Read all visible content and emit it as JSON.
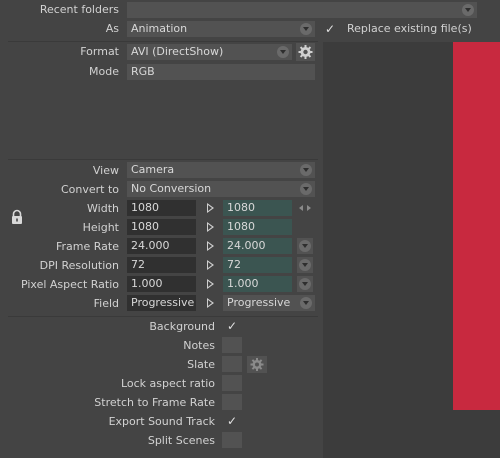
{
  "recent_folders": {
    "label": "Recent folders",
    "value": ""
  },
  "as": {
    "label": "As",
    "value": "Animation"
  },
  "replace_existing": {
    "label": "Replace existing file(s)",
    "checked": "✓"
  },
  "format": {
    "label": "Format",
    "value": "AVI (DirectShow)"
  },
  "mode": {
    "label": "Mode",
    "value": "RGB"
  },
  "view": {
    "label": "View",
    "value": "Camera"
  },
  "convert_to": {
    "label": "Convert to",
    "value": "No Conversion"
  },
  "width": {
    "label": "Width",
    "input": "1080",
    "output": "1080"
  },
  "height": {
    "label": "Height",
    "input": "1080",
    "output": "1080"
  },
  "frame_rate": {
    "label": "Frame Rate",
    "input": "24.000",
    "output": "24.000"
  },
  "dpi": {
    "label": "DPI Resolution",
    "input": "72",
    "output": "72"
  },
  "pixel_aspect": {
    "label": "Pixel Aspect Ratio",
    "input": "1.000",
    "output": "1.000"
  },
  "field": {
    "label": "Field",
    "input": "Progressive",
    "output": "Progressive"
  },
  "options": [
    {
      "label": "Background",
      "checked": "✓"
    },
    {
      "label": "Notes",
      "checked": ""
    },
    {
      "label": "Slate",
      "checked": ""
    },
    {
      "label": "Lock aspect ratio",
      "checked": ""
    },
    {
      "label": "Stretch to Frame Rate",
      "checked": ""
    },
    {
      "label": "Export Sound Track",
      "checked": "✓"
    },
    {
      "label": "Split Scenes",
      "checked": ""
    }
  ],
  "colors": {
    "preview_accent": "#c8293f",
    "output_field": "#3b5551"
  },
  "icons": [
    "gear-icon",
    "lock-icon",
    "link-arrows-icon",
    "play-arrow-icon",
    "dropdown-arrow-icon",
    "checkmark-icon"
  ]
}
